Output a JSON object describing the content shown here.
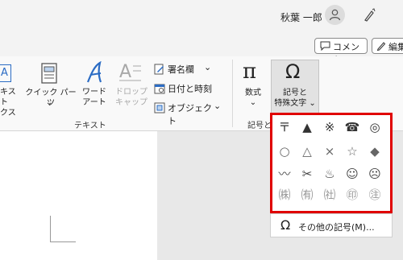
{
  "header": {
    "user_name": "秋葉 一郎",
    "comment_label": "コメント",
    "edit_label": "編集"
  },
  "ribbon": {
    "textbox_label_1": "キスト",
    "textbox_label_2": "クス",
    "quickparts_label": "クイック パーツ",
    "wordart_label_1": "ワード",
    "wordart_label_2": "アート",
    "dropcap_label_1": "ドロップ",
    "dropcap_label_2": "キャップ",
    "signature_label": "署名欄",
    "datetime_label": "日付と時刻",
    "object_label": "オブジェクト",
    "text_group_label": "テキスト",
    "equation_label": "数式",
    "symbol_label_1": "記号と",
    "symbol_label_2": "特殊文字",
    "symbols_group_label": "記号と"
  },
  "gallery": {
    "symbols": [
      "〒",
      "▲",
      "※",
      "☎",
      "◎",
      "○",
      "△",
      "×",
      "☆",
      "◆",
      "〰",
      "✂",
      "♨",
      "☺",
      "☹",
      "㈱",
      "㈲",
      "㈳",
      "㊞",
      "㊟"
    ]
  },
  "more_symbols_label": "その他の記号(M)..."
}
